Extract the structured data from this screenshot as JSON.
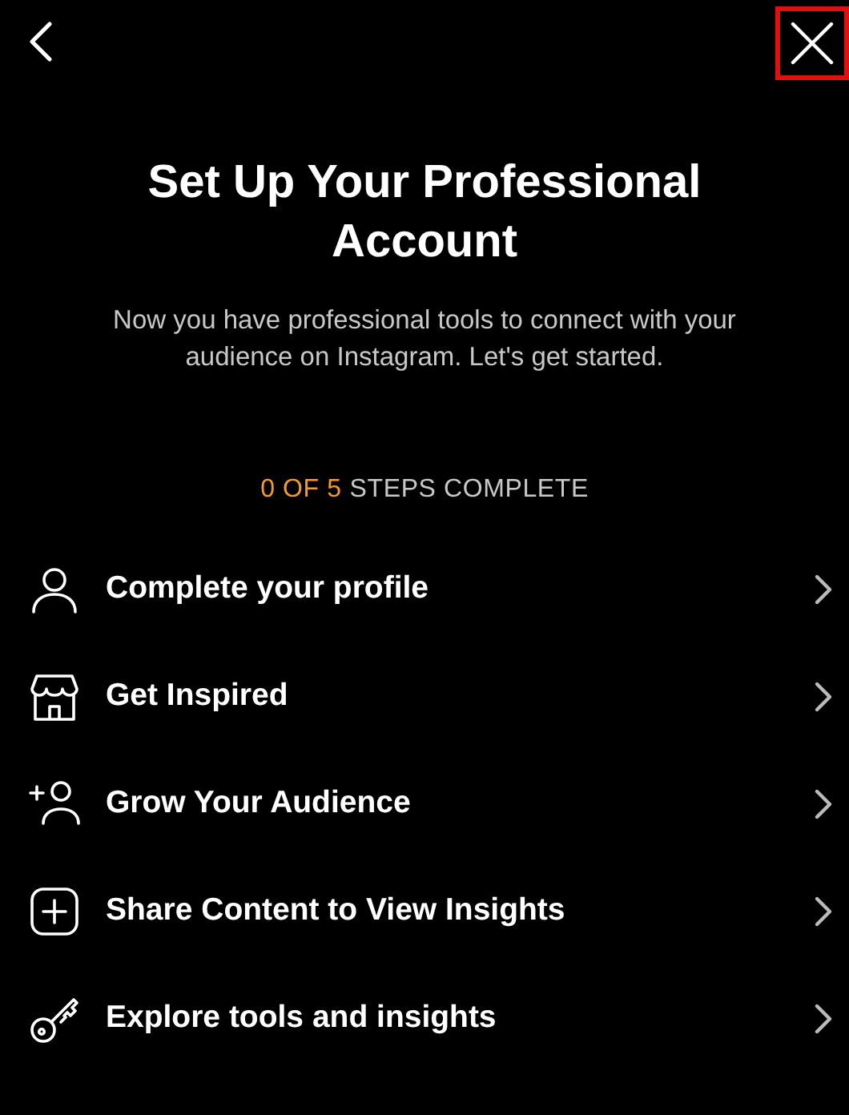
{
  "header": {
    "close_highlighted": true
  },
  "title": "Set Up Your Professional Account",
  "subtitle": "Now you have professional tools to connect with your audience on Instagram. Let's get started.",
  "progress": {
    "count": "0 OF 5",
    "label": "STEPS COMPLETE"
  },
  "steps": [
    {
      "label": "Complete your profile"
    },
    {
      "label": "Get Inspired"
    },
    {
      "label": "Grow Your Audience"
    },
    {
      "label": "Share Content to View Insights"
    },
    {
      "label": "Explore tools and insights"
    }
  ]
}
